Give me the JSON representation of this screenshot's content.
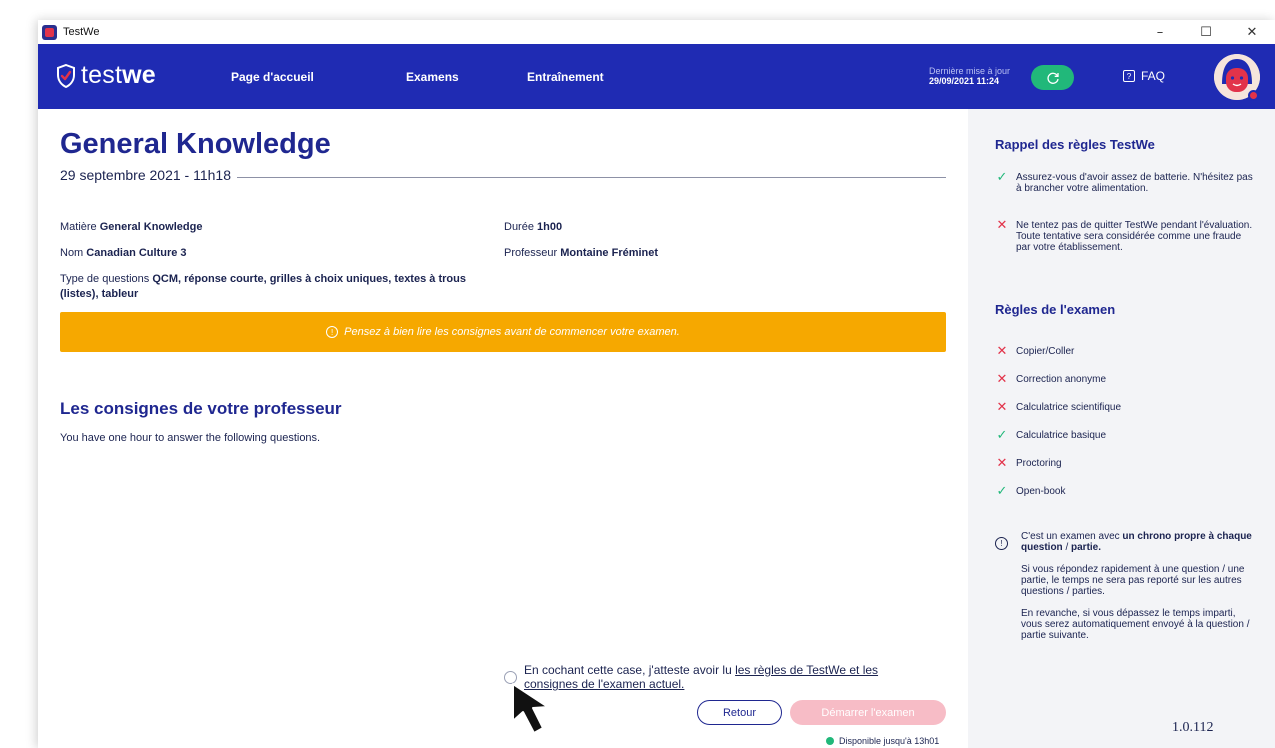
{
  "window": {
    "title": "TestWe",
    "minimize": "–",
    "maximize": "☐",
    "close": "✕"
  },
  "nav": {
    "logo_light": "test",
    "logo_bold": "we",
    "links": [
      "Page d'accueil",
      "Examens",
      "Entraînement"
    ],
    "update_label": "Dernière mise à jour",
    "update_value": "29/09/2021 11:24",
    "faq": "FAQ",
    "faq_icon": "?"
  },
  "exam": {
    "title": "General Knowledge",
    "date": "29 septembre 2021 - 11h18",
    "subject_label": "Matière",
    "subject": "General Knowledge",
    "name_label": "Nom",
    "name": "Canadian Culture 3",
    "qtype_label": "Type de questions",
    "qtype": "QCM, réponse courte, grilles à choix uniques, textes à trous (listes), tableur",
    "duration_label": "Durée",
    "duration": "1h00",
    "teacher_label": "Professeur",
    "teacher": "Montaine Fréminet"
  },
  "alert": {
    "icon": "!",
    "text": "Pensez à bien lire les consignes avant de commencer votre examen."
  },
  "instructions": {
    "title": "Les consignes de votre professeur",
    "text": "You have one hour to answer the following questions."
  },
  "consent": {
    "text_before": "En cochant cette case, j'atteste avoir lu ",
    "link": "les règles de TestWe et les consignes de l'examen actuel.",
    "checked": false
  },
  "buttons": {
    "back": "Retour",
    "start": "Démarrer l'examen"
  },
  "availability": "Disponible jusqu'à 13h01",
  "sidebar": {
    "rules_title": "Rappel des règles TestWe",
    "rules": [
      {
        "ok": true,
        "mark": "✓",
        "text": "Assurez-vous d'avoir assez de batterie. N'hésitez pas à brancher votre alimentation."
      },
      {
        "ok": false,
        "mark": "✕",
        "text": "Ne tentez pas de quitter TestWe pendant l'évaluation. Toute tentative sera considérée comme une fraude par votre établissement."
      }
    ],
    "exam_rules_title": "Règles de l'examen",
    "exam_rules": [
      {
        "ok": false,
        "mark": "✕",
        "text": "Copier/Coller"
      },
      {
        "ok": false,
        "mark": "✕",
        "text": "Correction anonyme"
      },
      {
        "ok": false,
        "mark": "✕",
        "text": "Calculatrice scientifique"
      },
      {
        "ok": true,
        "mark": "✓",
        "text": "Calculatrice basique"
      },
      {
        "ok": false,
        "mark": "✕",
        "text": "Proctoring"
      },
      {
        "ok": true,
        "mark": "✓",
        "text": "Open-book"
      }
    ],
    "info_icon": "!",
    "info_pre": "C'est un examen avec ",
    "info_bold1": "un chrono propre à chaque question",
    "info_mid": " / ",
    "info_bold2": "partie.",
    "info_p2": "Si vous répondez rapidement à une question / une partie, le temps ne sera pas reporté sur les autres questions / parties.",
    "info_p3": "En revanche, si vous dépassez le temps imparti, vous serez automatiquement envoyé à la question / partie suivante."
  },
  "version": "1.0.112",
  "colors": {
    "primary": "#1f2bb3",
    "warning": "#f6a800",
    "success": "#21b87a",
    "danger": "#e2334a",
    "start_disabled": "#f7bcc6"
  }
}
